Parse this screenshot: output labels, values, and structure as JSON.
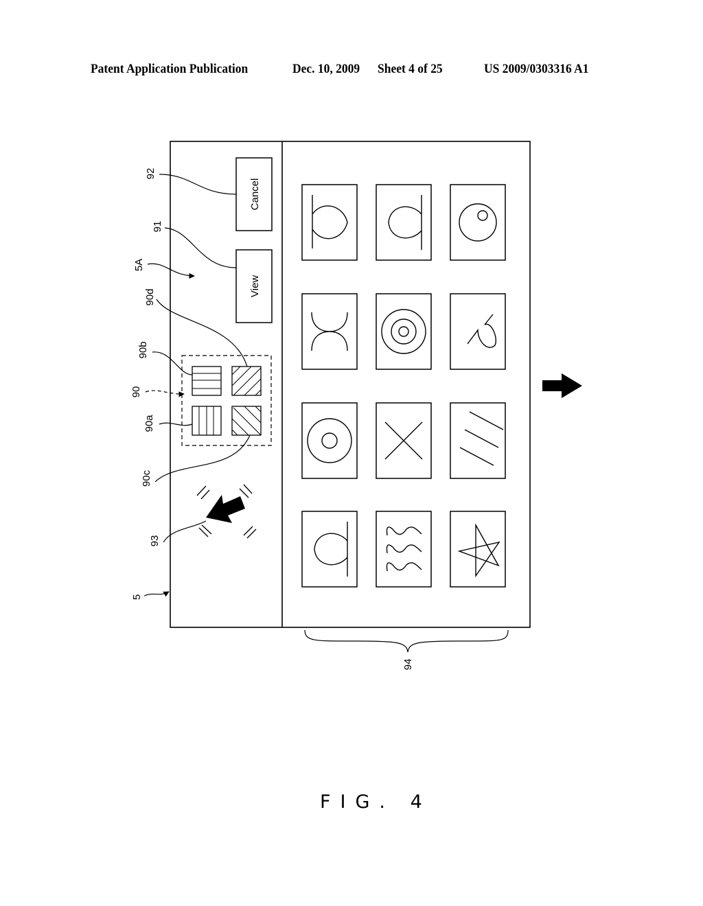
{
  "header": {
    "left": "Patent Application Publication",
    "date": "Dec. 10, 2009",
    "sheet": "Sheet 4 of 25",
    "number": "US 2009/0303316 A1"
  },
  "diagram": {
    "buttons": {
      "cancel": "Cancel",
      "view": "View"
    },
    "reference_labels": {
      "r92": "92",
      "r91": "91",
      "r5A": "5A",
      "r90d": "90d",
      "r90b": "90b",
      "r90": "90",
      "r90a": "90a",
      "r90c": "90c",
      "r93": "93",
      "r5": "5",
      "r94": "94"
    },
    "palette_swatches": [
      {
        "id": "90a",
        "pattern": "vertical-lines"
      },
      {
        "id": "90b",
        "pattern": "horizontal-lines"
      },
      {
        "id": "90c",
        "pattern": "diagonal-lines-down"
      },
      {
        "id": "90d",
        "pattern": "diagonal-lines-up"
      }
    ],
    "thumbnails": [
      {
        "row": 1,
        "col": 1,
        "shape": "fish-right"
      },
      {
        "row": 1,
        "col": 2,
        "shape": "fish-left"
      },
      {
        "row": 1,
        "col": 3,
        "shape": "circle-with-dot"
      },
      {
        "row": 2,
        "col": 1,
        "shape": "double-arc"
      },
      {
        "row": 2,
        "col": 2,
        "shape": "concentric-circles"
      },
      {
        "row": 2,
        "col": 3,
        "shape": "curl"
      },
      {
        "row": 3,
        "col": 1,
        "shape": "ring"
      },
      {
        "row": 3,
        "col": 2,
        "shape": "cross"
      },
      {
        "row": 3,
        "col": 3,
        "shape": "three-slashes"
      },
      {
        "row": 4,
        "col": 1,
        "shape": "fish-left"
      },
      {
        "row": 4,
        "col": 2,
        "shape": "waves"
      },
      {
        "row": 4,
        "col": 3,
        "shape": "star"
      }
    ]
  },
  "figure_label": "FIG. 4"
}
